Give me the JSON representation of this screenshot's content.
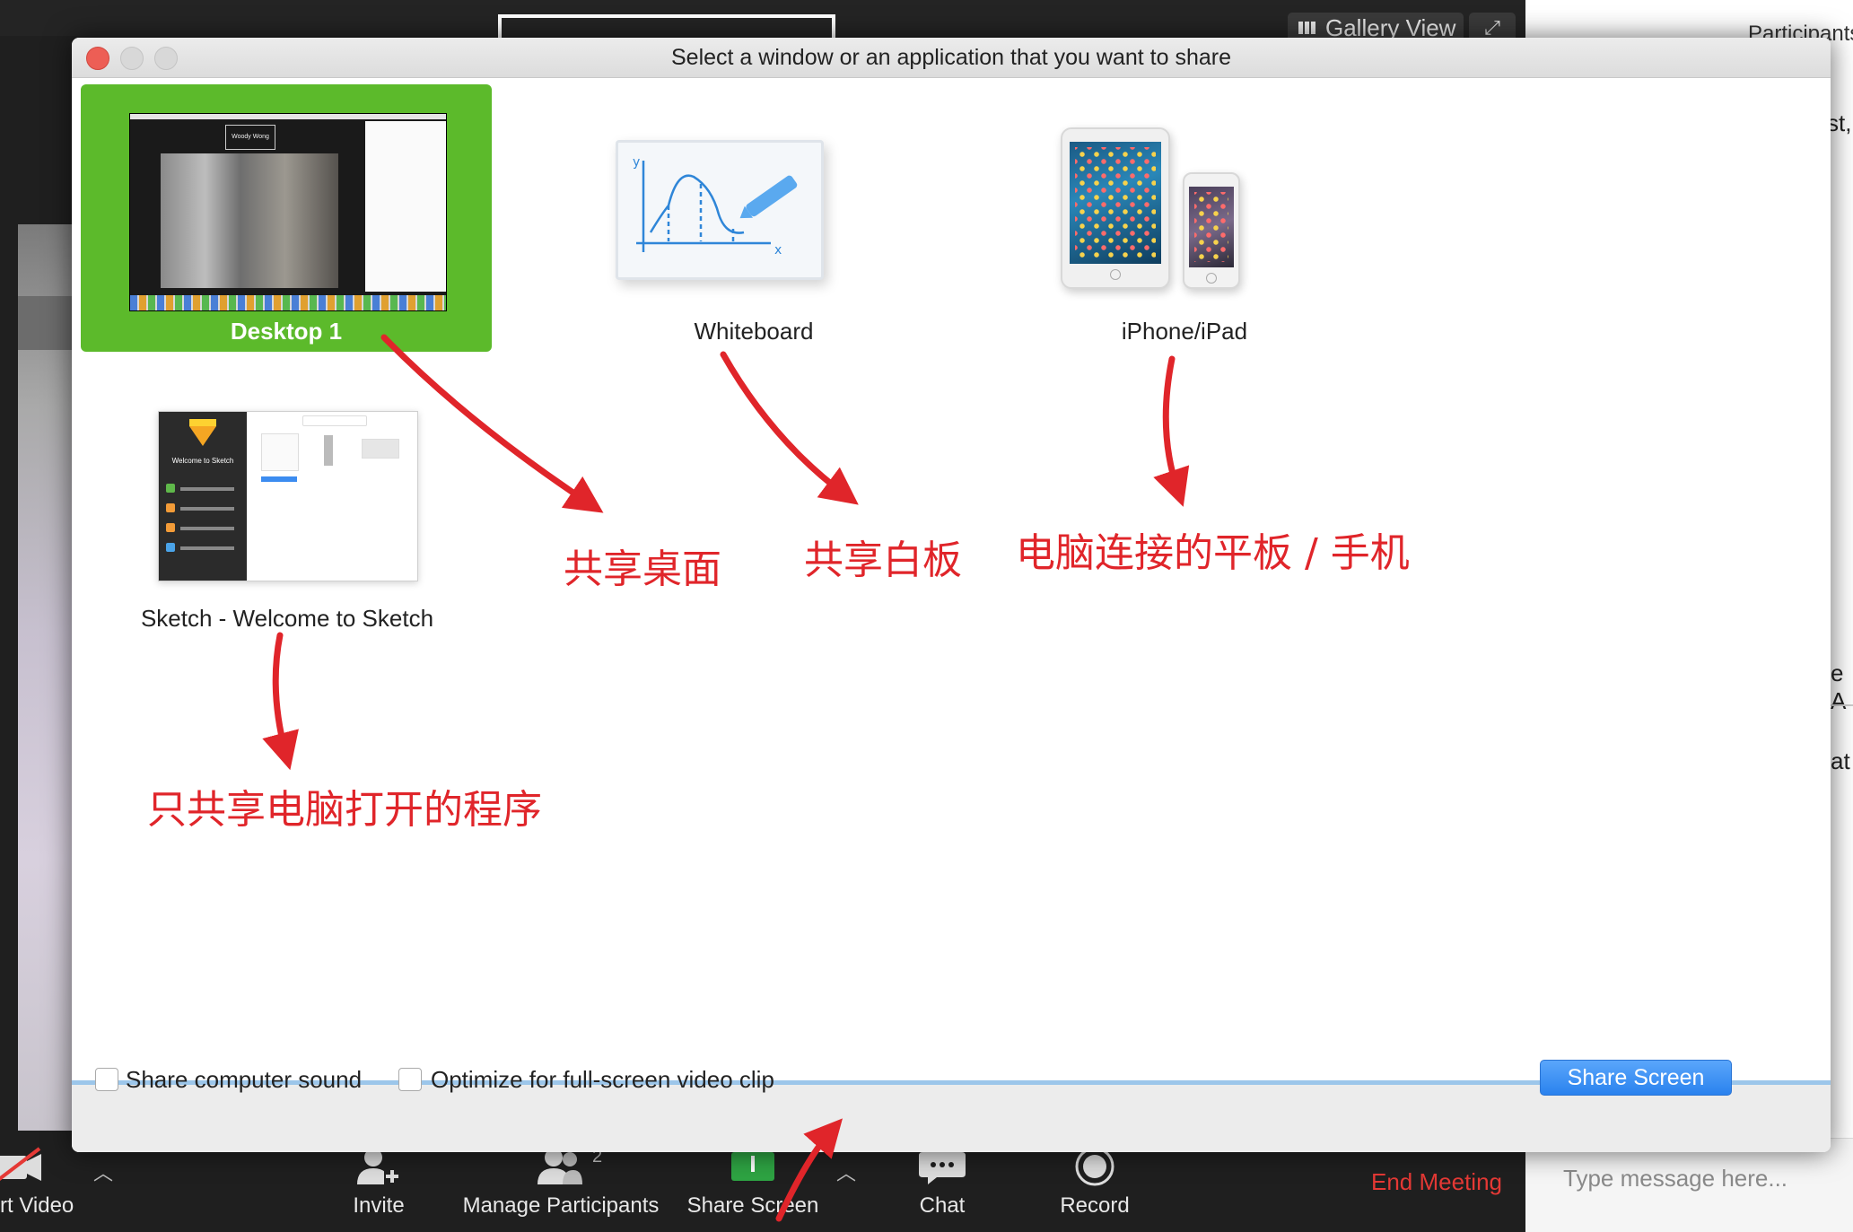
{
  "background": {
    "gallery_view_label": "Gallery View",
    "right_panel": {
      "participants_fragment": "Participants",
      "fragment_1": "st,",
      "fragment_2": "e A",
      "fragment_3": "at",
      "chat_placeholder": "Type message here..."
    },
    "toolbar": {
      "video_label": "rt Video",
      "invite_label": "Invite",
      "manage_participants_label": "Manage Participants",
      "participant_count": "2",
      "share_screen_label": "Share Screen",
      "chat_label": "Chat",
      "record_label": "Record",
      "end_meeting_label": "End Meeting"
    }
  },
  "dialog": {
    "title": "Select a window or an application that you want to share",
    "options": [
      {
        "label": "Desktop 1",
        "selected": true
      },
      {
        "label": "Whiteboard",
        "selected": false
      },
      {
        "label": "iPhone/iPad",
        "selected": false
      },
      {
        "label": "Sketch - Welcome to Sketch",
        "selected": false
      }
    ],
    "thumbnails": {
      "desktop_name": "Woody Wong",
      "sketch_welcome": "Welcome to Sketch"
    },
    "share_computer_sound_label": "Share computer sound",
    "optimize_video_label": "Optimize for full-screen video clip",
    "share_button_label": "Share Screen"
  },
  "annotations": {
    "desktop": "共享桌面",
    "whiteboard": "共享白板",
    "device": "电脑连接的平板 / 手机",
    "app": "只共享电脑打开的程序"
  },
  "colors": {
    "selected_tile": "#5cba2b",
    "annotation_red": "#e0252a",
    "share_button_blue": "#2a82ee",
    "end_meeting_red": "#e53935"
  }
}
